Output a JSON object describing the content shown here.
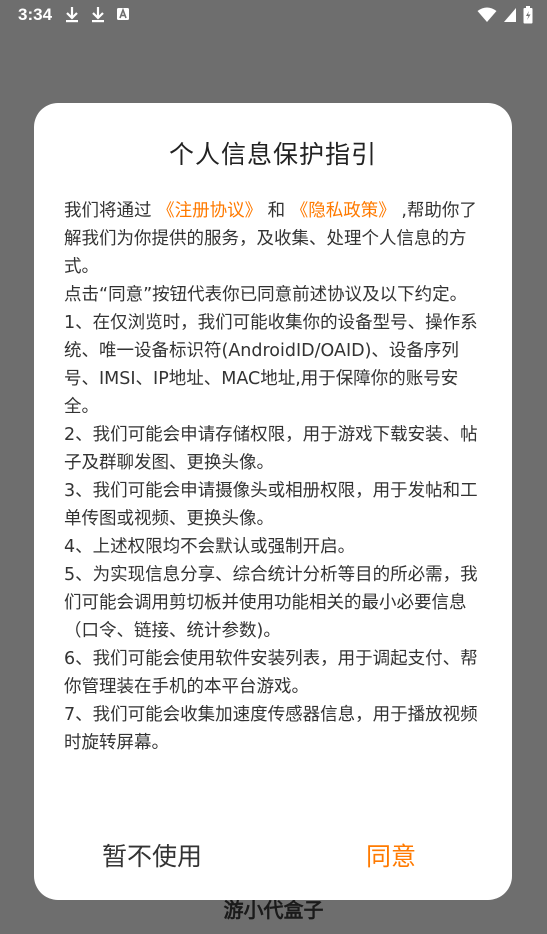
{
  "status_bar": {
    "time": "3:34",
    "icons_left": [
      "download-icon",
      "download-icon",
      "app-notification-icon"
    ],
    "icons_right": [
      "wifi-icon",
      "signal-icon",
      "battery-icon"
    ]
  },
  "background": {
    "app_title": "游小代盒子"
  },
  "dialog": {
    "title": "个人信息保护指引",
    "intro_prefix": "我们将通过",
    "link_register": "《注册协议》",
    "and_word": "和",
    "link_privacy": "《隐私政策》",
    "intro_suffix": ",帮助你了解我们为你提供的服务，及收集、处理个人信息的方式。",
    "paragraphs": [
      " 点击“同意”按钮代表你已同意前述协议及以下约定。",
      " 1、在仅浏览时，我们可能收集你的设备型号、操作系统、唯一设备标识符(AndroidID/OAID)、设备序列号、IMSI、IP地址、MAC地址,用于保障你的账号安全。",
      " 2、我们可能会申请存储权限，用于游戏下载安装、帖子及群聊发图、更换头像。",
      " 3、我们可能会申请摄像头或相册权限，用于发帖和工单传图或视频、更换头像。",
      " 4、上述权限均不会默认或强制开启。",
      " 5、为实现信息分享、综合统计分析等目的所必需，我们可能会调用剪切板并使用功能相关的最小必要信息（口令、链接、统计参数)。",
      " 6、我们可能会使用软件安装列表，用于调起支付、帮你管理装在手机的本平台游戏。",
      " 7、我们可能会收集加速度传感器信息，用于播放视频时旋转屏幕。"
    ],
    "decline_label": "暂不使用",
    "agree_label": "同意",
    "accent_color": "#ff7a00"
  }
}
